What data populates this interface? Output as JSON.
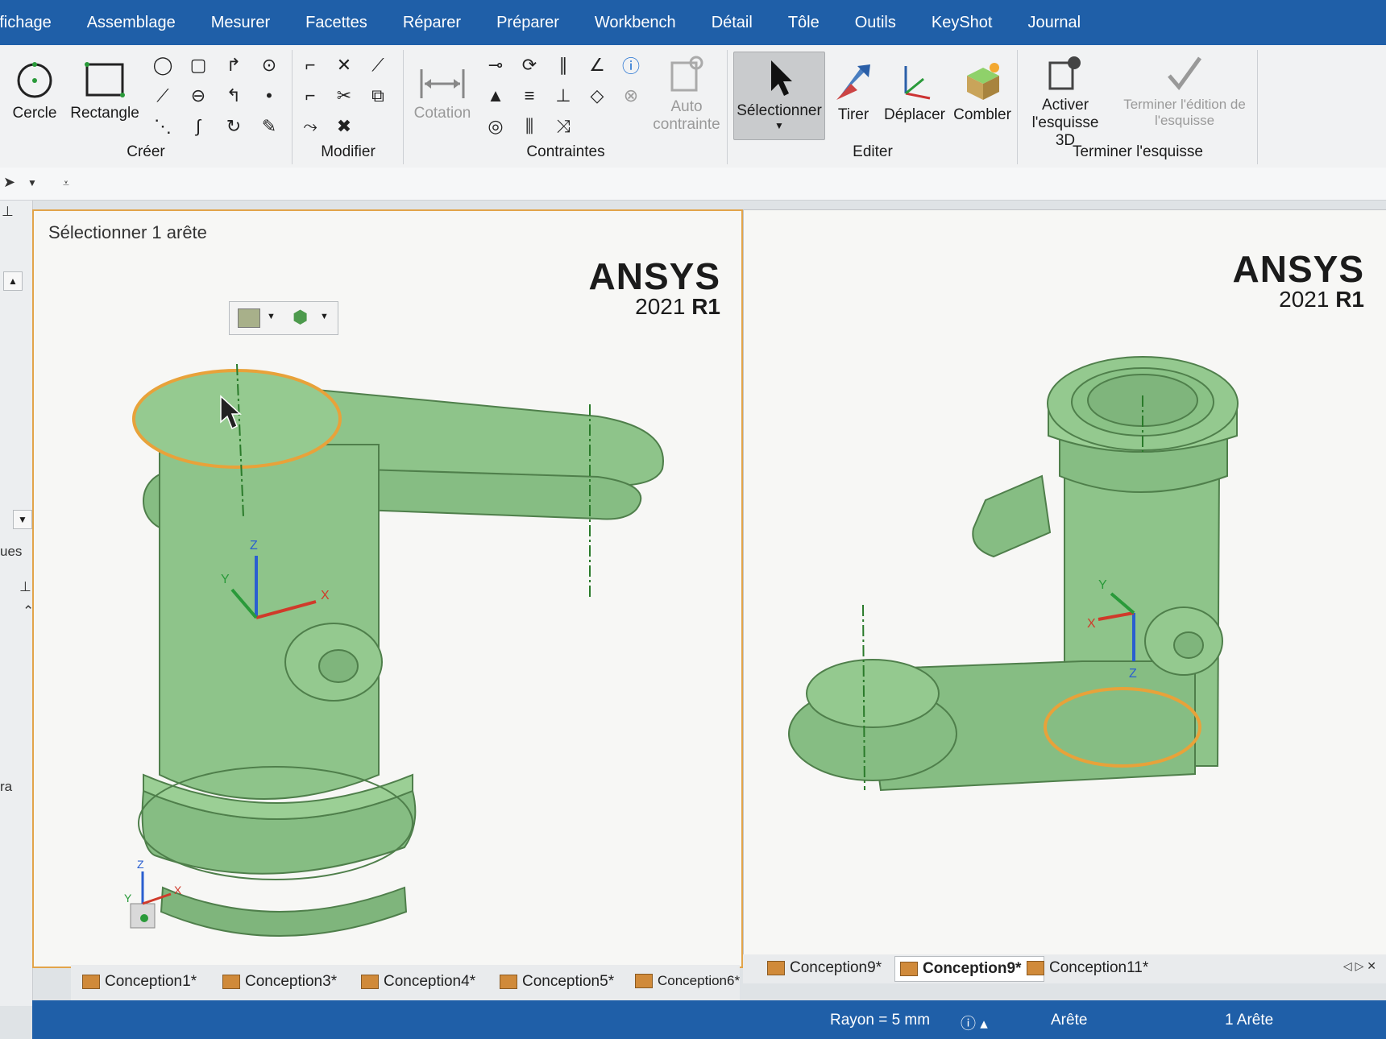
{
  "menu": [
    "ffichage",
    "Assemblage",
    "Mesurer",
    "Facettes",
    "Réparer",
    "Préparer",
    "Workbench",
    "Détail",
    "Tôle",
    "Outils",
    "KeyShot",
    "Journal"
  ],
  "ribbon": {
    "creer": {
      "label": "Créer",
      "circle": "Cercle",
      "rectangle": "Rectangle"
    },
    "modifier": {
      "label": "Modifier"
    },
    "contraintes": {
      "label": "Contraintes",
      "cotation": "Cotation",
      "auto_line1": "Auto",
      "auto_line2": "contrainte"
    },
    "editer": {
      "label": "Editer",
      "select": "Sélectionner",
      "pull": "Tirer",
      "move": "Déplacer",
      "fill": "Combler"
    },
    "terminer": {
      "label": "Terminer l'esquisse",
      "activate_line1": "Activer",
      "activate_line2": "l'esquisse 3D",
      "finish_line1": "Terminer l'édition de",
      "finish_line2": "l'esquisse"
    }
  },
  "left_strip": {
    "tab1": "ues",
    "tab2": "ra"
  },
  "viewport_left": {
    "hint": "Sélectionner 1 arête",
    "brand": "ANSYS",
    "version": "2021",
    "release": "R1"
  },
  "viewport_right": {
    "brand": "ANSYS",
    "version": "2021",
    "release": "R1"
  },
  "axes": {
    "x": "X",
    "y": "Y",
    "z": "Z"
  },
  "tabs_left": [
    "Conception1*",
    "Conception3*",
    "Conception4*",
    "Conception5*",
    "Conception6*",
    "Conception9*"
  ],
  "tabs_right": [
    {
      "label": "Conception9*",
      "active": true
    },
    {
      "label": "Conception11*",
      "active": false
    }
  ],
  "status": {
    "radius": "Rayon = 5 mm",
    "type": "Arête",
    "count": "1 Arête"
  },
  "colors": {
    "model_green": "#8ec48a",
    "selection": "#e8a23a",
    "menu_blue": "#1f5fa8"
  }
}
